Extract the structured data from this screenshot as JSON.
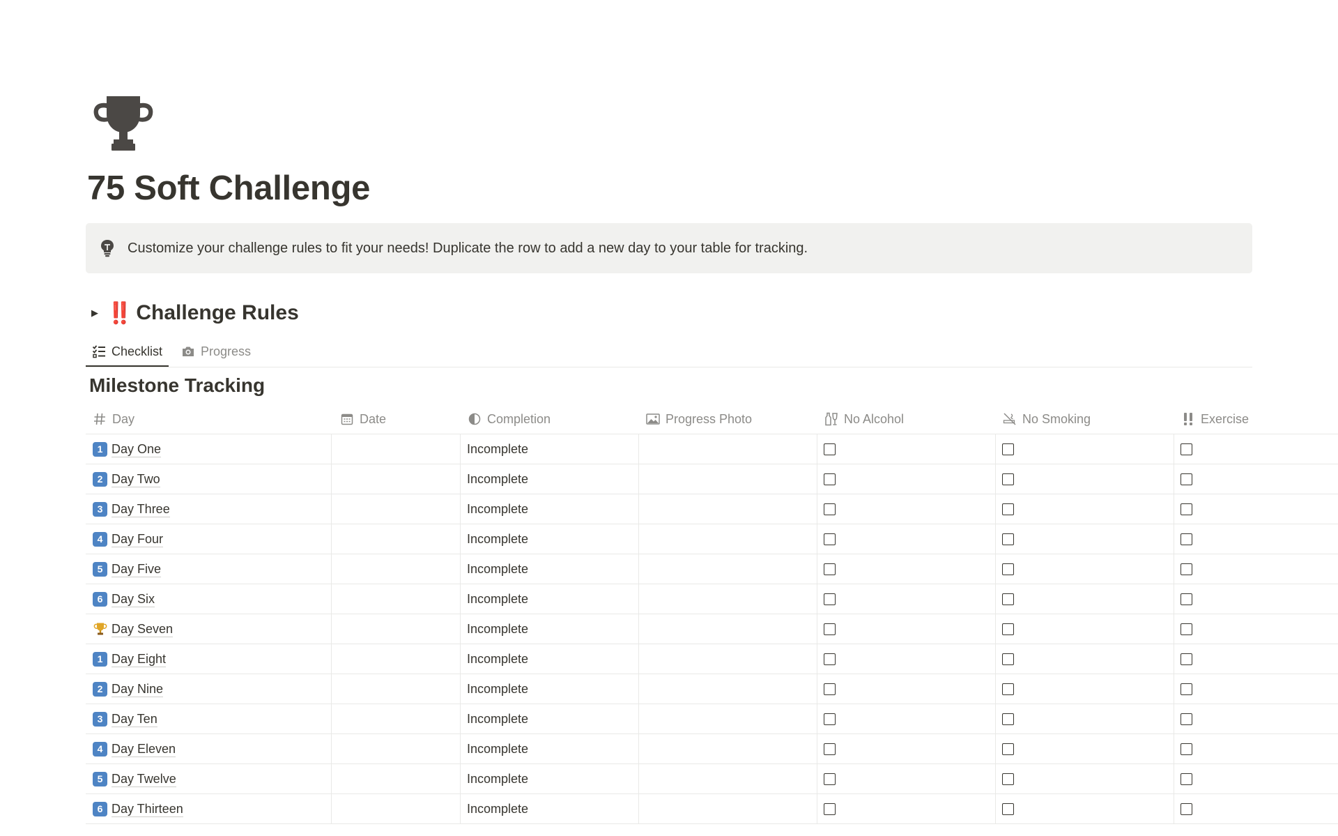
{
  "page": {
    "title": "75 Soft Challenge",
    "icon": "trophy-icon",
    "callout": {
      "icon": "lightbulb-icon",
      "text": "Customize your challenge rules to fit your needs! Duplicate the row to add a new day to your table for tracking."
    },
    "toggle": {
      "emoji": "‼️",
      "title": "Challenge Rules"
    }
  },
  "tabs": [
    {
      "label": "Checklist",
      "icon": "checklist-icon",
      "active": true
    },
    {
      "label": "Progress",
      "icon": "camera-icon",
      "active": false
    }
  ],
  "database": {
    "title": "Milestone Tracking",
    "columns": [
      {
        "label": "Day",
        "icon": "hash-icon"
      },
      {
        "label": "Date",
        "icon": "calendar-icon"
      },
      {
        "label": "Completion",
        "icon": "formula-icon"
      },
      {
        "label": "Progress Photo",
        "icon": "image-icon"
      },
      {
        "label": "No Alcohol",
        "icon": "bottle-icon"
      },
      {
        "label": "No Smoking",
        "icon": "no-smoking-icon"
      },
      {
        "label": "Exercise",
        "icon": "exclamation-icon"
      }
    ],
    "rows": [
      {
        "badge": "1",
        "name": "Day One",
        "date": "",
        "completion": "Incomplete",
        "no_alcohol": false,
        "no_smoking": false,
        "exercise": false
      },
      {
        "badge": "2",
        "name": "Day Two",
        "date": "",
        "completion": "Incomplete",
        "no_alcohol": false,
        "no_smoking": false,
        "exercise": false
      },
      {
        "badge": "3",
        "name": "Day Three",
        "date": "",
        "completion": "Incomplete",
        "no_alcohol": false,
        "no_smoking": false,
        "exercise": false
      },
      {
        "badge": "4",
        "name": "Day Four",
        "date": "",
        "completion": "Incomplete",
        "no_alcohol": false,
        "no_smoking": false,
        "exercise": false
      },
      {
        "badge": "5",
        "name": "Day Five",
        "date": "",
        "completion": "Incomplete",
        "no_alcohol": false,
        "no_smoking": false,
        "exercise": false
      },
      {
        "badge": "6",
        "name": "Day Six",
        "date": "",
        "completion": "Incomplete",
        "no_alcohol": false,
        "no_smoking": false,
        "exercise": false
      },
      {
        "badge": "trophy",
        "name": "Day Seven",
        "date": "",
        "completion": "Incomplete",
        "no_alcohol": false,
        "no_smoking": false,
        "exercise": false
      },
      {
        "badge": "1",
        "name": "Day Eight",
        "date": "",
        "completion": "Incomplete",
        "no_alcohol": false,
        "no_smoking": false,
        "exercise": false
      },
      {
        "badge": "2",
        "name": "Day Nine",
        "date": "",
        "completion": "Incomplete",
        "no_alcohol": false,
        "no_smoking": false,
        "exercise": false
      },
      {
        "badge": "3",
        "name": "Day Ten",
        "date": "",
        "completion": "Incomplete",
        "no_alcohol": false,
        "no_smoking": false,
        "exercise": false
      },
      {
        "badge": "4",
        "name": "Day Eleven",
        "date": "",
        "completion": "Incomplete",
        "no_alcohol": false,
        "no_smoking": false,
        "exercise": false
      },
      {
        "badge": "5",
        "name": "Day Twelve",
        "date": "",
        "completion": "Incomplete",
        "no_alcohol": false,
        "no_smoking": false,
        "exercise": false
      },
      {
        "badge": "6",
        "name": "Day Thirteen",
        "date": "",
        "completion": "Incomplete",
        "no_alcohol": false,
        "no_smoking": false,
        "exercise": false
      }
    ]
  },
  "colors": {
    "text": "#37352f",
    "muted": "#8c8b88",
    "callout_bg": "#f1f1ef",
    "badge_blue": "#4e84c4",
    "toggle_emoji_red": "#e03e2d",
    "divider": "#e9e9e7"
  }
}
